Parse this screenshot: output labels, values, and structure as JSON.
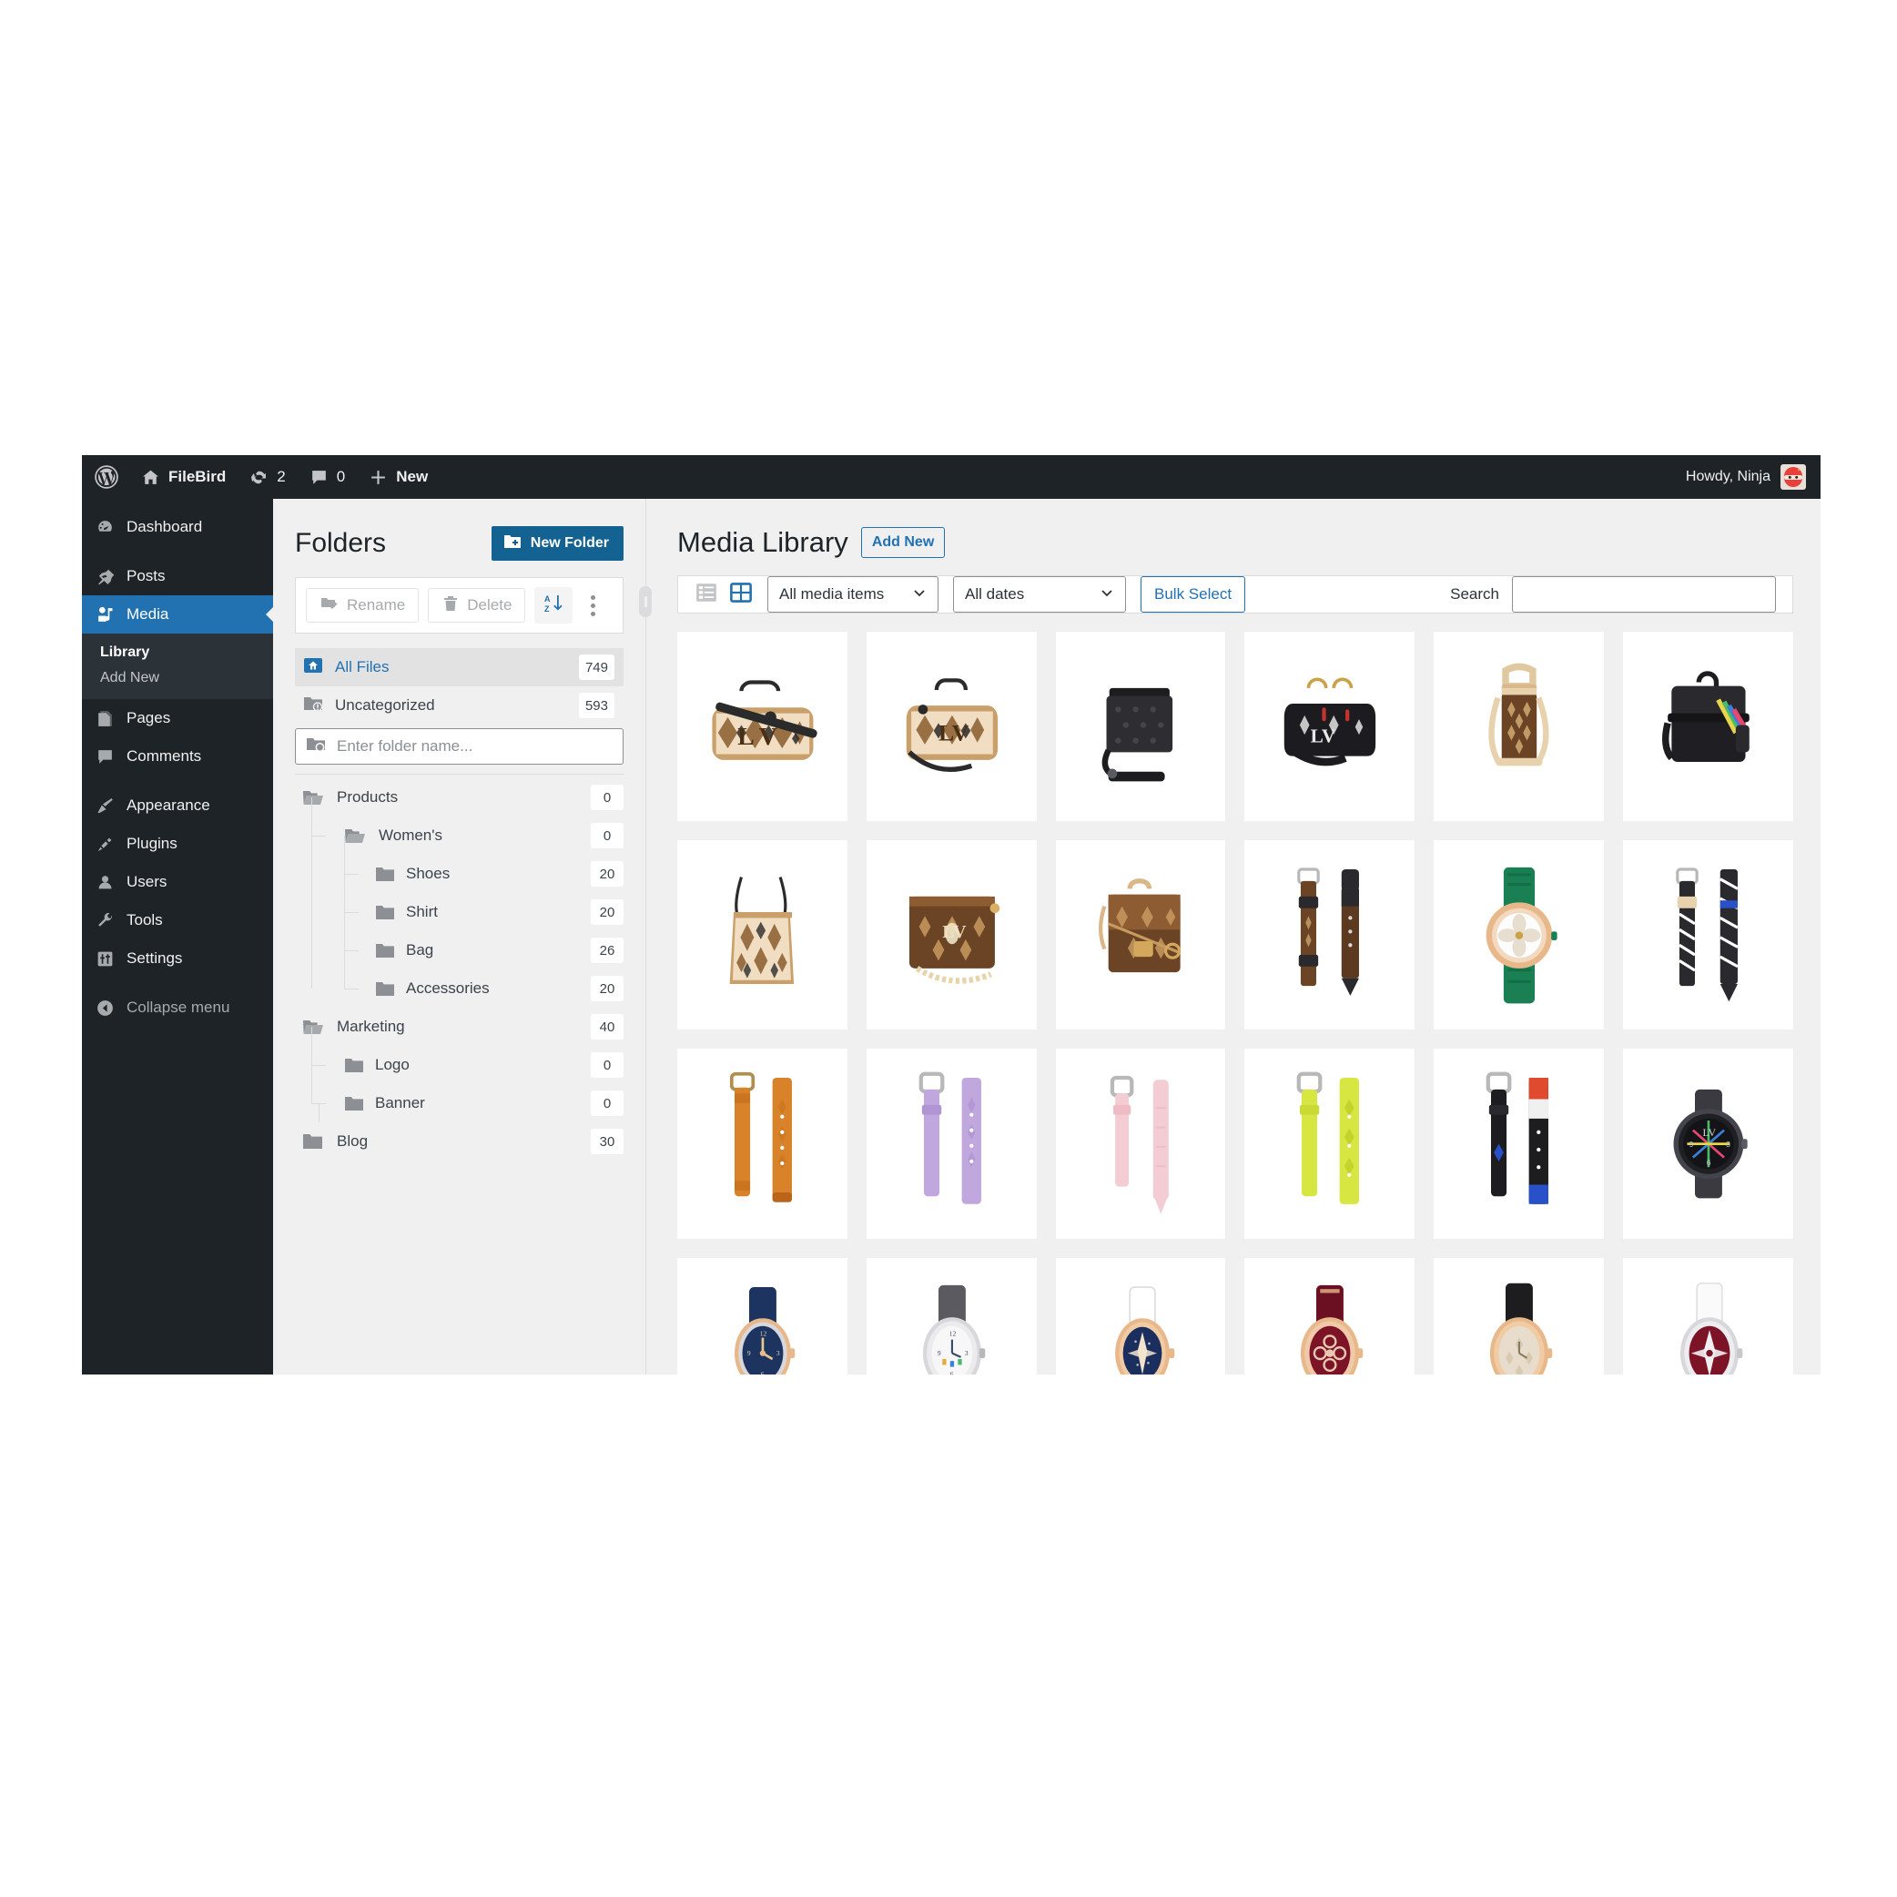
{
  "adminbar": {
    "logo_icon": "wordpress-logo-icon",
    "site_icon": "home-icon",
    "site_name": "FileBird",
    "updates_icon": "updates-icon",
    "updates_count": "2",
    "comments_icon": "comment-bubble-icon",
    "comments_count": "0",
    "new_icon": "plus-icon",
    "new_label": "New",
    "howdy": "Howdy, Ninja",
    "avatar_icon": "ninja-avatar-icon"
  },
  "adminmenu": {
    "items": [
      {
        "label": "Dashboard",
        "icon": "dashboard-icon"
      },
      {
        "label": "Posts",
        "icon": "pin-icon"
      },
      {
        "label": "Media",
        "icon": "media-icon"
      },
      {
        "label": "Pages",
        "icon": "pages-icon"
      },
      {
        "label": "Comments",
        "icon": "comment-icon"
      },
      {
        "label": "Appearance",
        "icon": "brush-icon"
      },
      {
        "label": "Plugins",
        "icon": "plug-icon"
      },
      {
        "label": "Users",
        "icon": "user-icon"
      },
      {
        "label": "Tools",
        "icon": "wrench-icon"
      },
      {
        "label": "Settings",
        "icon": "sliders-icon"
      },
      {
        "label": "Collapse menu",
        "icon": "collapse-arrow-icon"
      }
    ],
    "media_submenu": [
      {
        "label": "Library",
        "current": true
      },
      {
        "label": "Add New",
        "current": false
      }
    ]
  },
  "folders": {
    "title": "Folders",
    "new_folder_label": "New Folder",
    "new_folder_icon": "folder-plus-icon",
    "toolbar": {
      "rename_label": "Rename",
      "rename_icon": "folder-pencil-icon",
      "delete_label": "Delete",
      "delete_icon": "trash-icon",
      "sort_icon": "sort-az-icon",
      "more_icon": "three-dots-vertical-icon"
    },
    "all_files": {
      "label": "All Files",
      "count": "749",
      "icon": "home-folder-icon"
    },
    "uncategorized": {
      "label": "Uncategorized",
      "count": "593",
      "icon": "folder-alert-icon"
    },
    "search": {
      "placeholder": "Enter folder name...",
      "value": "",
      "icon": "folder-search-icon"
    },
    "tree": [
      {
        "label": "Products",
        "count": "0",
        "depth": 0,
        "icon": "folder-open-icon"
      },
      {
        "label": "Women's",
        "count": "0",
        "depth": 1,
        "icon": "folder-open-icon"
      },
      {
        "label": "Shoes",
        "count": "20",
        "depth": 2,
        "icon": "folder-icon"
      },
      {
        "label": "Shirt",
        "count": "20",
        "depth": 2,
        "icon": "folder-icon"
      },
      {
        "label": "Bag",
        "count": "26",
        "depth": 2,
        "icon": "folder-icon"
      },
      {
        "label": "Accessories",
        "count": "20",
        "depth": 2,
        "icon": "folder-icon"
      },
      {
        "label": "Marketing",
        "count": "40",
        "depth": 0,
        "icon": "folder-open-icon"
      },
      {
        "label": "Logo",
        "count": "0",
        "depth": 1,
        "icon": "folder-icon"
      },
      {
        "label": "Banner",
        "count": "0",
        "depth": 1,
        "icon": "folder-icon"
      },
      {
        "label": "Blog",
        "count": "30",
        "depth": 0,
        "icon": "folder-icon"
      }
    ],
    "resizer_icon": "panel-resize-handle-icon"
  },
  "media": {
    "title": "Media Library",
    "add_new_label": "Add New",
    "toolbar": {
      "list_view_icon": "list-view-icon",
      "grid_view_icon": "grid-view-icon",
      "media_filter_value": "All media items",
      "date_filter_value": "All dates",
      "bulk_select_label": "Bulk Select",
      "search_label": "Search",
      "search_value": "",
      "chevron_icon": "chevron-down-icon"
    },
    "grid_items": [
      {
        "name": "monogram-keepall-bag",
        "kind": "duffle-bag",
        "colors": [
          "#c79161",
          "#f1e2cd",
          "#2b2b2b"
        ]
      },
      {
        "name": "monogram-speedy-bag",
        "kind": "speedy-bag",
        "colors": [
          "#c79161",
          "#f1e2cd",
          "#2b2b2b"
        ]
      },
      {
        "name": "black-flat-messenger",
        "kind": "flat-pouch",
        "colors": [
          "#2a2a2e",
          "#3c3c42",
          "#1a1a1d"
        ]
      },
      {
        "name": "black-alma-bag",
        "kind": "alma-bag",
        "colors": [
          "#1c1c1f",
          "#d8d8d8",
          "#c4342f"
        ]
      },
      {
        "name": "monogram-bottle-holder",
        "kind": "bottle-bag",
        "colors": [
          "#6b4426",
          "#e8cfa8",
          "#caa46f"
        ]
      },
      {
        "name": "black-rainbow-backpack",
        "kind": "backpack",
        "colors": [
          "#1d1d20",
          "#36363a",
          "#e8476f"
        ]
      },
      {
        "name": "monogram-neverfull-tote",
        "kind": "tote-bag",
        "colors": [
          "#c79161",
          "#f1e2cd",
          "#2b2b2b"
        ]
      },
      {
        "name": "monogram-felicie-pochette",
        "kind": "flap-bag",
        "colors": [
          "#6b4426",
          "#8d5c32",
          "#e8d9ae"
        ]
      },
      {
        "name": "monogram-metis-bag",
        "kind": "metis-bag",
        "colors": [
          "#6b4426",
          "#8d5c32",
          "#d3a85c"
        ]
      },
      {
        "name": "brown-monogram-strap",
        "kind": "strap-pair",
        "colors": [
          "#6b4426",
          "#2a2a2e",
          "#d8d8d8"
        ]
      },
      {
        "name": "green-gold-watch",
        "kind": "round-watch",
        "colors": [
          "#1a7f52",
          "#e8b88a",
          "#ffffff"
        ]
      },
      {
        "name": "blue-white-print-strap",
        "kind": "strap-pair",
        "colors": [
          "#2a2a2e",
          "#ffffff",
          "#2850c8"
        ]
      },
      {
        "name": "orange-leather-strap",
        "kind": "strap-pair",
        "colors": [
          "#d88229",
          "#c97420",
          "#b8b8b8"
        ]
      },
      {
        "name": "purple-leather-strap",
        "kind": "strap-pair",
        "colors": [
          "#c0a8de",
          "#b095d4",
          "#b8b8b8"
        ]
      },
      {
        "name": "pink-leather-strap",
        "kind": "strap-pair",
        "colors": [
          "#f4cdd4",
          "#efbcc6",
          "#b8b8b8"
        ]
      },
      {
        "name": "yellow-monogram-strap",
        "kind": "strap-pair",
        "colors": [
          "#d7e641",
          "#c9d935",
          "#b8b8b8"
        ]
      },
      {
        "name": "black-graphic-strap",
        "kind": "strap-pair",
        "colors": [
          "#1d1d20",
          "#2850c8",
          "#e04a2f"
        ]
      },
      {
        "name": "black-tambour-smartwatch",
        "kind": "round-watch",
        "colors": [
          "#2c2c30",
          "#1a1a1d",
          "#e8476f"
        ]
      },
      {
        "name": "navy-dial-watch",
        "kind": "oval-watch",
        "colors": [
          "#1d3461",
          "#e8b88a",
          "#d8d8d8"
        ]
      },
      {
        "name": "white-dial-grey-watch",
        "kind": "oval-watch",
        "colors": [
          "#f2f2f2",
          "#5a5a60",
          "#d8d8d8"
        ]
      },
      {
        "name": "navy-star-dial-watch",
        "kind": "oval-watch",
        "colors": [
          "#1b2f5e",
          "#e8b88a",
          "#ffffff"
        ]
      },
      {
        "name": "burgundy-flower-watch",
        "kind": "oval-watch",
        "colors": [
          "#7d1327",
          "#e8b88a",
          "#f0c9a8"
        ]
      },
      {
        "name": "cream-monogram-watch",
        "kind": "oval-watch",
        "colors": [
          "#e8ddcd",
          "#1d1d20",
          "#e8b88a"
        ]
      },
      {
        "name": "white-burgundy-watch",
        "kind": "oval-watch",
        "colors": [
          "#ffffff",
          "#7d1327",
          "#d8d8d8"
        ]
      }
    ]
  },
  "colors": {
    "accent": "#2271b1",
    "admin_dark": "#1d2327",
    "submenu_dark": "#2c3338",
    "page_bg": "#f0f0f1",
    "brand_blue": "#136292"
  }
}
